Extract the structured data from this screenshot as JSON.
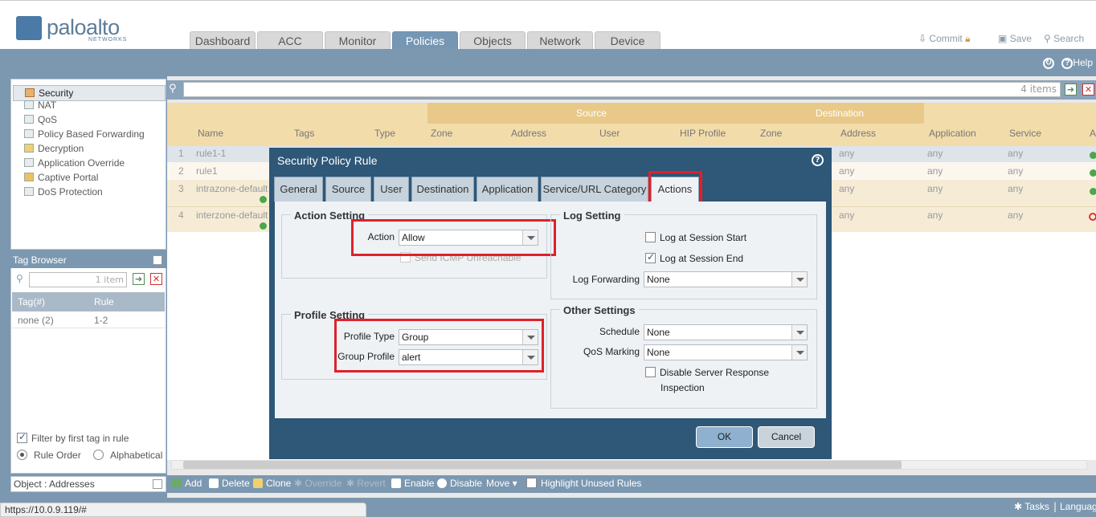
{
  "brand": {
    "name": "paloalto",
    "sub": "NETWORKS"
  },
  "top_tabs": [
    "Dashboard",
    "ACC",
    "Monitor",
    "Policies",
    "Objects",
    "Network",
    "Device"
  ],
  "top_actions": {
    "commit": "Commit",
    "save": "Save",
    "search": "Search"
  },
  "help": "Help",
  "nav_items": [
    "Security",
    "NAT",
    "QoS",
    "Policy Based Forwarding",
    "Decryption",
    "Application Override",
    "Captive Portal",
    "DoS Protection"
  ],
  "tag_browser": {
    "title": "Tag Browser",
    "search_placeholder": "1 item",
    "col_tag": "Tag(#)",
    "col_rule": "Rule",
    "row_tag": "none (2)",
    "row_rule": "1-2",
    "filter_label": "Filter by first tag in rule",
    "rule_order": "Rule Order",
    "alphabetical": "Alphabetical"
  },
  "object_panel": "Object : Addresses",
  "filter": {
    "count": "4 items"
  },
  "table": {
    "group_source": "Source",
    "group_destination": "Destination",
    "headers": [
      "Name",
      "Tags",
      "Type",
      "Zone",
      "Address",
      "User",
      "HIP Profile",
      "Zone",
      "Address",
      "Application",
      "Service",
      "A"
    ],
    "rows": [
      {
        "num": "1",
        "name": "rule1-1",
        "address": "any",
        "application": "any",
        "service": "any"
      },
      {
        "num": "2",
        "name": "rule1",
        "address": "any",
        "application": "any",
        "service": "any"
      },
      {
        "num": "3",
        "name": "intrazone-default",
        "address": "any",
        "application": "any",
        "service": "any"
      },
      {
        "num": "4",
        "name": "interzone-default",
        "address": "any",
        "application": "any",
        "service": "any"
      }
    ]
  },
  "toolbar": {
    "add": "Add",
    "delete": "Delete",
    "clone": "Clone",
    "override": "Override",
    "revert": "Revert",
    "enable": "Enable",
    "disable": "Disable",
    "move": "Move",
    "highlight": "Highlight Unused Rules"
  },
  "status": {
    "url": "https://10.0.9.119/#",
    "tasks": "Tasks",
    "language": "Language"
  },
  "dialog": {
    "title": "Security Policy Rule",
    "tabs": [
      "General",
      "Source",
      "User",
      "Destination",
      "Application",
      "Service/URL Category",
      "Actions"
    ],
    "action_setting": {
      "legend": "Action Setting",
      "action_label": "Action",
      "action_value": "Allow",
      "icmp_label": "Send ICMP Unreachable"
    },
    "profile_setting": {
      "legend": "Profile Setting",
      "profile_type_label": "Profile Type",
      "profile_type_value": "Group",
      "group_profile_label": "Group Profile",
      "group_profile_value": "alert"
    },
    "log_setting": {
      "legend": "Log Setting",
      "log_start": "Log at Session Start",
      "log_end": "Log at Session End",
      "forwarding_label": "Log Forwarding",
      "forwarding_value": "None"
    },
    "other_settings": {
      "legend": "Other Settings",
      "schedule_label": "Schedule",
      "schedule_value": "None",
      "qos_label": "QoS Marking",
      "qos_value": "None",
      "disable_inspection_line1": "Disable Server Response",
      "disable_inspection_line2": "Inspection"
    },
    "ok": "OK",
    "cancel": "Cancel"
  }
}
